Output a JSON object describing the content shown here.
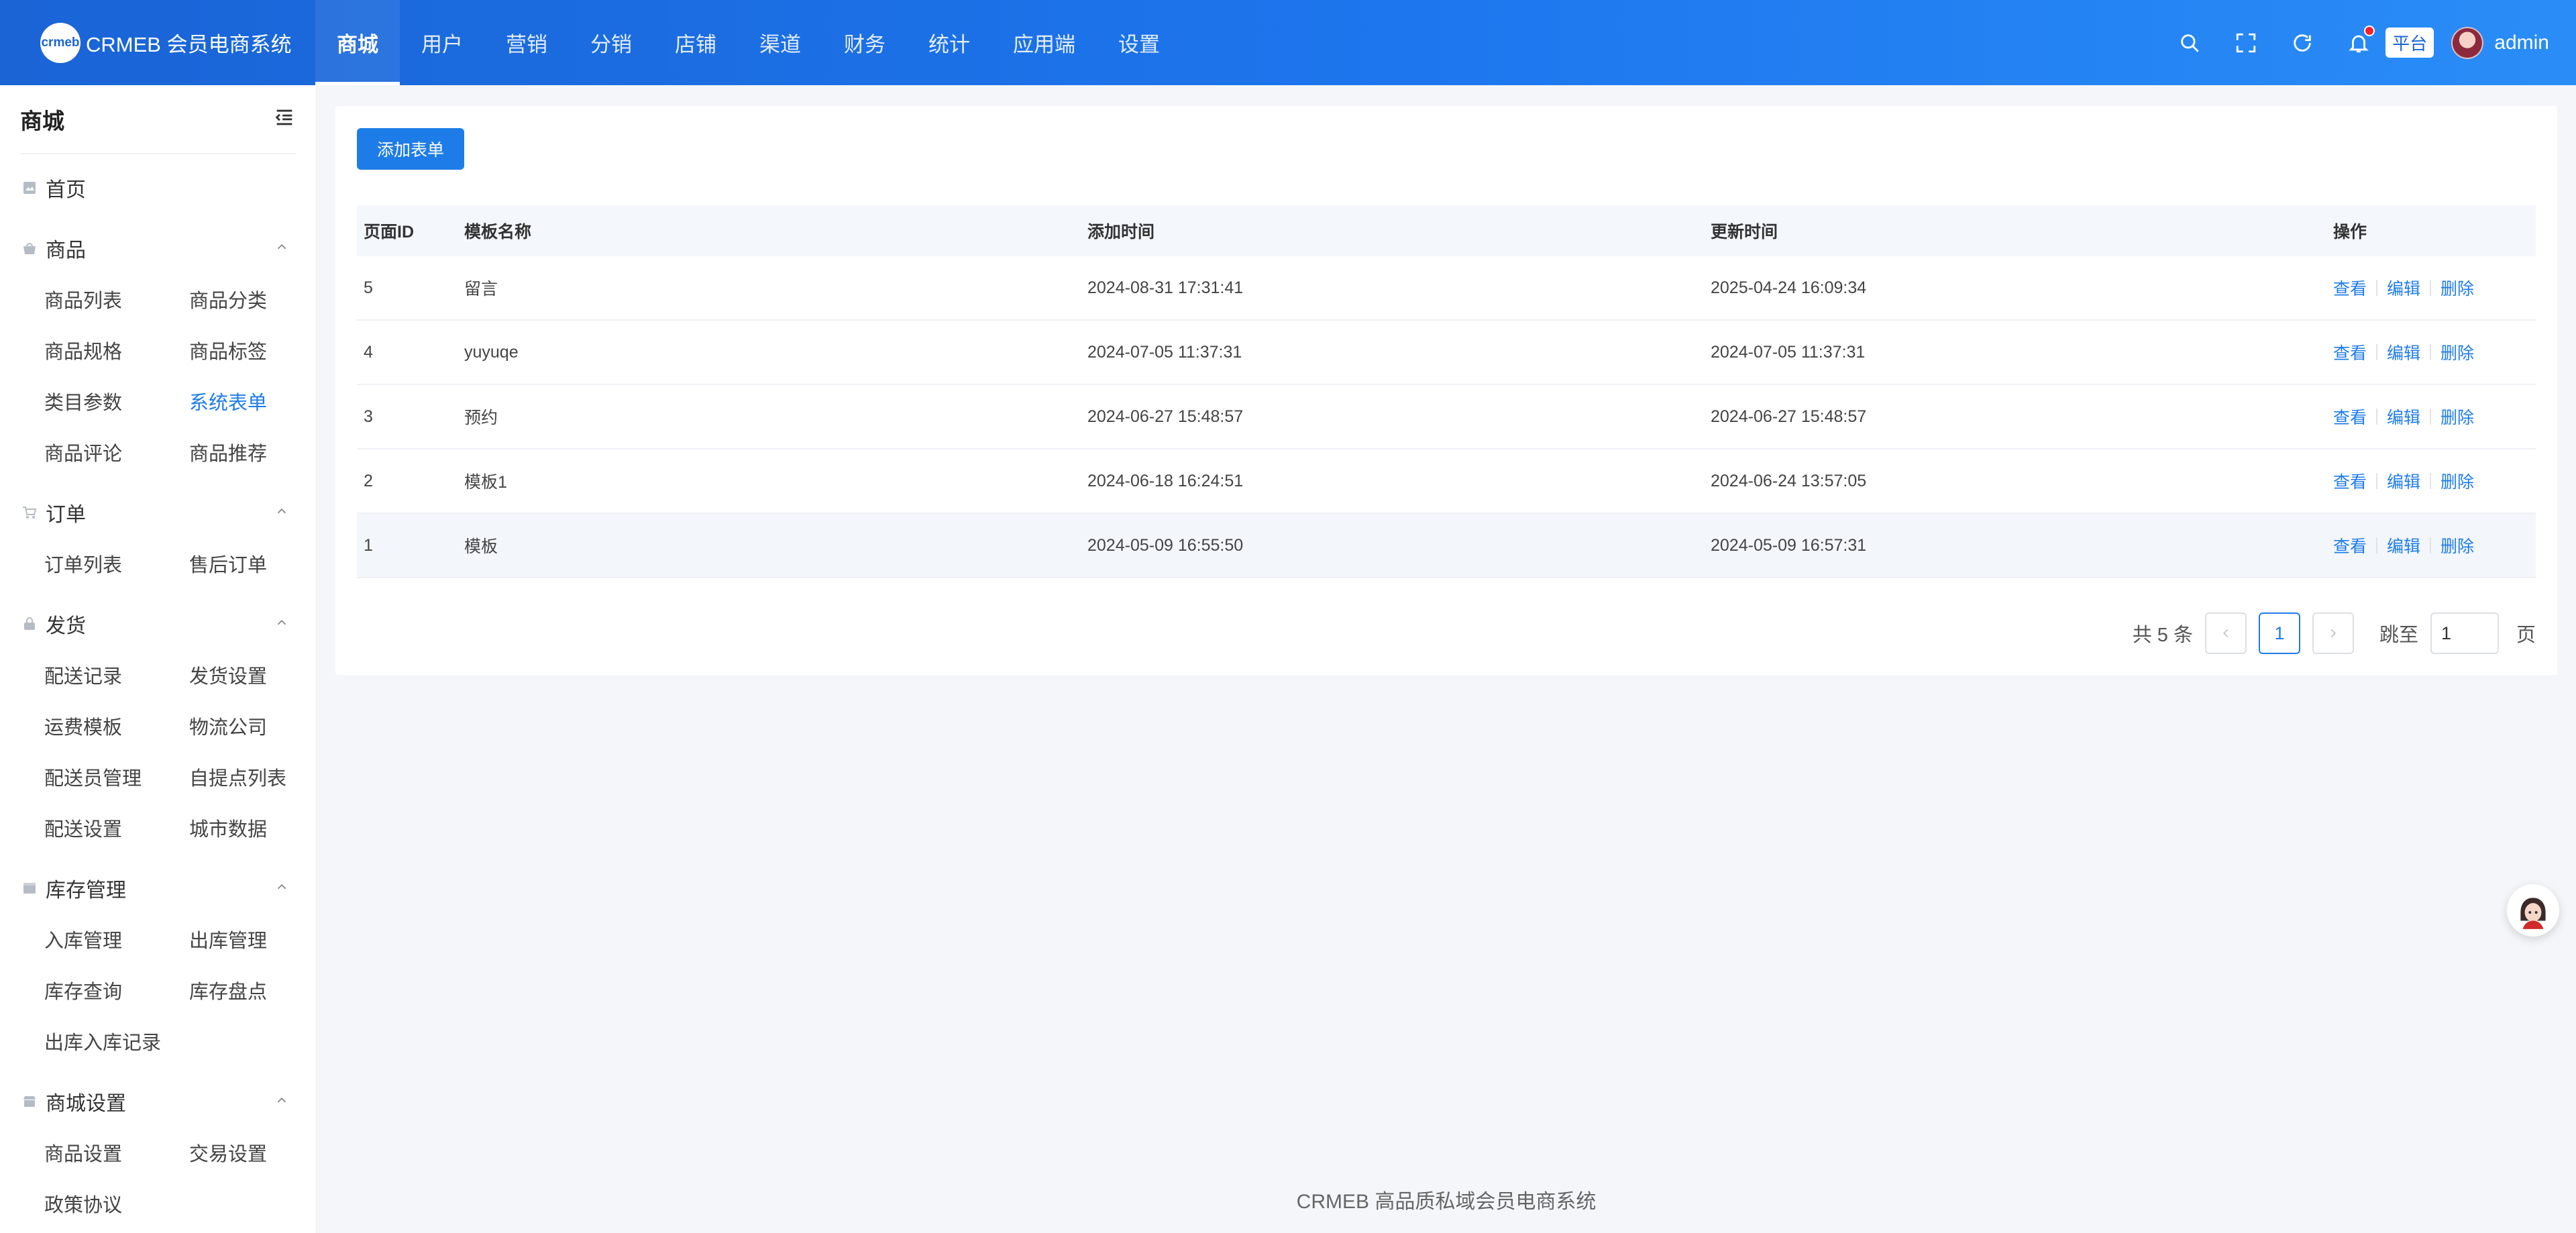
{
  "brand": {
    "logo_text": "crmeb",
    "name": "CRMEB 会员电商系统"
  },
  "topnav": [
    {
      "label": "商城",
      "active": true
    },
    {
      "label": "用户"
    },
    {
      "label": "营销"
    },
    {
      "label": "分销"
    },
    {
      "label": "店铺"
    },
    {
      "label": "渠道"
    },
    {
      "label": "财务"
    },
    {
      "label": "统计"
    },
    {
      "label": "应用端"
    },
    {
      "label": "设置"
    }
  ],
  "topbar": {
    "platform_tag": "平台",
    "username": "admin",
    "has_notification": true
  },
  "sidebar": {
    "title": "商城",
    "home": "首页",
    "groups": [
      {
        "label": "商品",
        "icon": "bag-icon",
        "items": [
          "商品列表",
          "商品分类",
          "商品规格",
          "商品标签",
          "类目参数",
          "系统表单",
          "商品评论",
          "商品推荐"
        ]
      },
      {
        "label": "订单",
        "icon": "cart-icon",
        "items": [
          "订单列表",
          "售后订单"
        ]
      },
      {
        "label": "发货",
        "icon": "lock-icon",
        "items": [
          "配送记录",
          "发货设置",
          "运费模板",
          "物流公司",
          "配送员管理",
          "自提点列表",
          "配送设置",
          "城市数据"
        ]
      },
      {
        "label": "库存管理",
        "icon": "box-icon",
        "items": [
          "入库管理",
          "出库管理",
          "库存查询",
          "库存盘点",
          "出库入库记录"
        ]
      },
      {
        "label": "商城设置",
        "icon": "store-icon",
        "items": [
          "商品设置",
          "交易设置",
          "政策协议"
        ]
      }
    ],
    "active_item": "系统表单"
  },
  "page": {
    "add_button": "添加表单",
    "columns": [
      "页面ID",
      "模板名称",
      "添加时间",
      "更新时间",
      "操作"
    ],
    "actions": [
      "查看",
      "编辑",
      "删除"
    ],
    "rows": [
      {
        "id": "5",
        "name": "留言",
        "added": "2024-08-31 17:31:41",
        "updated": "2025-04-24 16:09:34"
      },
      {
        "id": "4",
        "name": "yuyuqe",
        "added": "2024-07-05 11:37:31",
        "updated": "2024-07-05 11:37:31"
      },
      {
        "id": "3",
        "name": "预约",
        "added": "2024-06-27 15:48:57",
        "updated": "2024-06-27 15:48:57"
      },
      {
        "id": "2",
        "name": "模板1",
        "added": "2024-06-18 16:24:51",
        "updated": "2024-06-24 13:57:05"
      },
      {
        "id": "1",
        "name": "模板",
        "added": "2024-05-09 16:55:50",
        "updated": "2024-05-09 16:57:31",
        "highlighted": true
      }
    ],
    "pagination": {
      "total_text": "共 5 条",
      "current_page": "1",
      "jump_label": "跳至",
      "jump_value": "1",
      "page_unit": "页"
    }
  },
  "footer": "CRMEB 高品质私域会员电商系统",
  "colors": {
    "primary": "#1e7ce8",
    "topbar_start": "#1a64d6",
    "topbar_end": "#2a8df7",
    "notification": "#f5222d"
  }
}
